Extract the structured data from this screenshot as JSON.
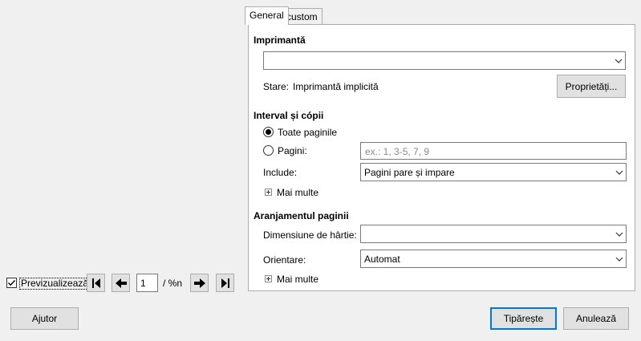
{
  "tabs": [
    "General",
    "custom"
  ],
  "printer": {
    "section_title": "Imprimantă",
    "selected": "",
    "status_label": "Stare:",
    "status_value": "Imprimantă implicită",
    "properties_button": "Proprietăți..."
  },
  "range": {
    "section_title": "Interval și cópii",
    "all_pages_label": "Toate paginile",
    "pages_label": "Pagini:",
    "pages_placeholder": "ex.: 1, 3-5, 7, 9",
    "include_label": "Include:",
    "include_value": "Pagini pare și impare",
    "more_label": "Mai multe"
  },
  "layout": {
    "section_title": "Aranjamentul paginii",
    "paper_size_label": "Dimensiune de hârtie:",
    "paper_size_value": "",
    "orientation_label": "Orientare:",
    "orientation_value": "Automat",
    "more_label": "Mai multe"
  },
  "preview": {
    "checkbox_label": "Previzualizează",
    "checked": true,
    "page_value": "1",
    "page_total": "/ %n"
  },
  "footer": {
    "help_button": "Ajutor",
    "print_button": "Tipărește",
    "cancel_button": "Anulează"
  }
}
